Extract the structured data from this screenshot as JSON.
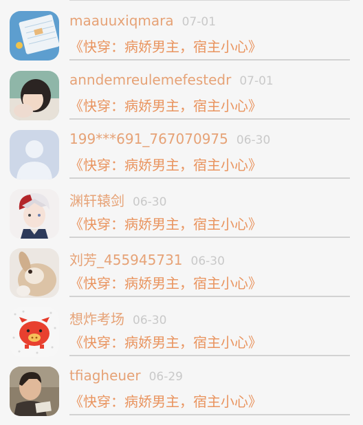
{
  "items": [
    {
      "username": "maauuxiqmara",
      "date": "07-01",
      "book": "《快穿：病娇男主，宿主小心》",
      "avatar_icon": "map-avatar"
    },
    {
      "username": "anndemreulemefestedr",
      "date": "07-01",
      "book": "《快穿：病娇男主，宿主小心》",
      "avatar_icon": "girl-photo-avatar"
    },
    {
      "username": "199***691_767070975",
      "date": "06-30",
      "book": "《快穿：病娇男主，宿主小心》",
      "avatar_icon": "default-user-avatar"
    },
    {
      "username": "渊轩辕剑",
      "date": "06-30",
      "book": "《快穿：病娇男主，宿主小心》",
      "avatar_icon": "anime-boy-avatar"
    },
    {
      "username": "刘芳_455945731",
      "date": "06-30",
      "book": "《快穿：病娇男主，宿主小心》",
      "avatar_icon": "rabbit-avatar"
    },
    {
      "username": "想炸考场",
      "date": "06-30",
      "book": "《快穿：病娇男主，宿主小心》",
      "avatar_icon": "red-pig-avatar"
    },
    {
      "username": "tfiagheuer",
      "date": "06-29",
      "book": "《快穿：病娇男主，宿主小心》",
      "avatar_icon": "man-photo-avatar"
    }
  ],
  "colors": {
    "username": "#e6a276",
    "book_title": "#e9945f",
    "date": "#c9c9c9",
    "background": "#f6f6f6",
    "divider": "#d2d2d2"
  }
}
